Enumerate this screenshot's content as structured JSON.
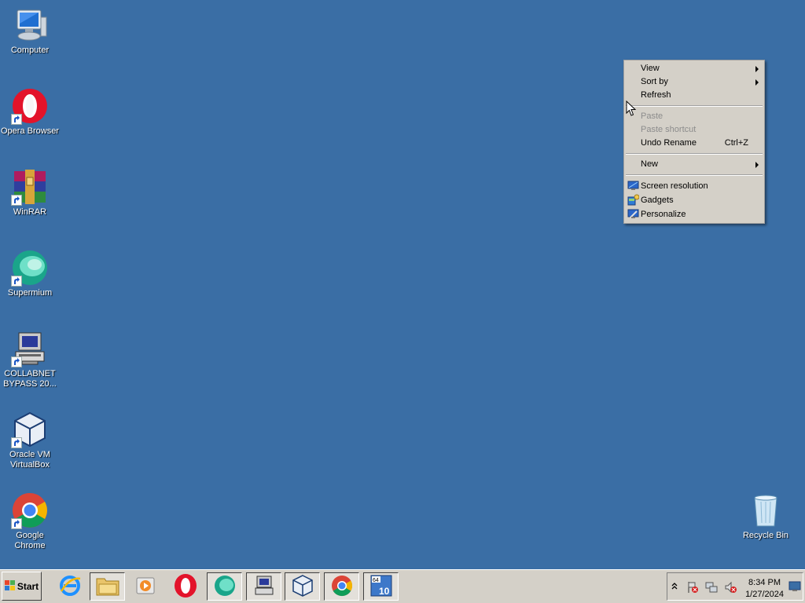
{
  "desktop": {
    "background": "#3a6ea5",
    "icons": [
      {
        "label": "Computer",
        "icon": "computer-icon",
        "shortcut": false
      },
      {
        "label": "Opera Browser",
        "icon": "opera-icon",
        "shortcut": true
      },
      {
        "label": "WinRAR",
        "icon": "winrar-icon",
        "shortcut": true
      },
      {
        "label": "Supermium",
        "icon": "supermium-icon",
        "shortcut": true
      },
      {
        "label": "COLLABNET\nBYPASS 20...",
        "icon": "network-pc-icon",
        "shortcut": true
      },
      {
        "label": "Oracle VM\nVirtualBox",
        "icon": "virtualbox-icon",
        "shortcut": true
      },
      {
        "label": "Google Chrome",
        "icon": "chrome-icon",
        "shortcut": true
      },
      {
        "label": "Recycle Bin",
        "icon": "recycle-bin-icon",
        "shortcut": false
      }
    ]
  },
  "context_menu": {
    "items": [
      {
        "label": "View",
        "submenu": true
      },
      {
        "label": "Sort by",
        "submenu": true
      },
      {
        "label": "Refresh"
      },
      {
        "label": "Paste",
        "disabled": true
      },
      {
        "label": "Paste shortcut",
        "disabled": true
      },
      {
        "label": "Undo Rename",
        "shortcut": "Ctrl+Z"
      },
      {
        "label": "New",
        "submenu": true
      },
      {
        "label": "Screen resolution",
        "icon": "screen-resolution-icon"
      },
      {
        "label": "Gadgets",
        "icon": "gadgets-icon"
      },
      {
        "label": "Personalize",
        "icon": "personalize-icon"
      }
    ]
  },
  "taskbar": {
    "start_label": "Start",
    "pinned": [
      "internet-explorer-icon",
      "file-explorer-icon",
      "media-player-icon",
      "opera-icon",
      "supermium-icon",
      "network-pc-icon",
      "virtualbox-icon",
      "chrome-icon",
      "app-64-10-icon"
    ],
    "tray": {
      "icons": [
        "show-hidden-icons",
        "action-center-flag-icon",
        "network-icon",
        "volume-muted-icon",
        "show-desktop-icon"
      ],
      "time": "8:34 PM",
      "date": "1/27/2024"
    }
  }
}
